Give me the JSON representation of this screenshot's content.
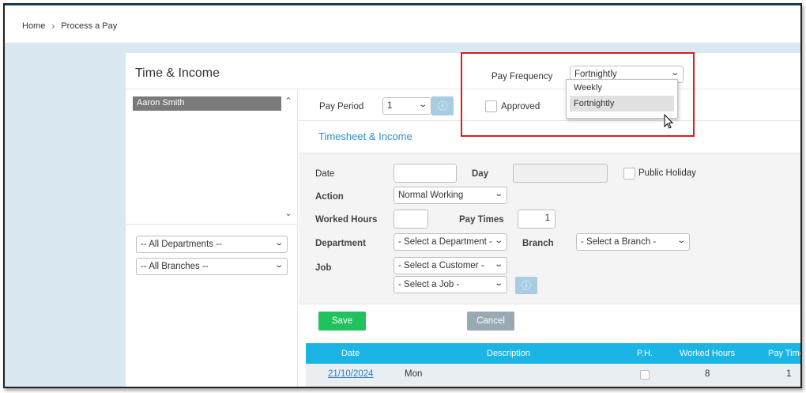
{
  "breadcrumb": {
    "home": "Home",
    "separator": "›",
    "current": "Process a Pay"
  },
  "panel": {
    "title": "Time & Income"
  },
  "employees": {
    "items": [
      "Aaron Smith"
    ]
  },
  "filters": {
    "departments": "-- All Departments --",
    "branches": "-- All Branches --"
  },
  "pay_frequency": {
    "label": "Pay Frequency",
    "selected": "Fortnightly",
    "options": [
      "Weekly",
      "Fortnightly"
    ]
  },
  "pay_period": {
    "label": "Pay Period",
    "value": "1"
  },
  "approved": {
    "label": "Approved"
  },
  "section_title": "Timesheet & Income",
  "form": {
    "date_label": "Date",
    "day_label": "Day",
    "public_holiday_label": "Public Holiday",
    "action_label": "Action",
    "action_value": "Normal Working",
    "worked_hours_label": "Worked Hours",
    "pay_times_label": "Pay Times",
    "pay_times_value": "1",
    "department_label": "Department",
    "department_value": "- Select a Department -",
    "branch_label": "Branch",
    "branch_value": "- Select a Branch -",
    "job_label": "Job",
    "customer_value": "- Select a Customer -",
    "job_value": "- Select a Job -"
  },
  "buttons": {
    "save": "Save",
    "cancel": "Cancel"
  },
  "table": {
    "headers": [
      "Date",
      "Description",
      "P.H.",
      "Worked Hours",
      "Pay Time"
    ],
    "rows": [
      {
        "date": "21/10/2024",
        "description": "Mon",
        "worked_hours": "8",
        "pay_times": "1"
      }
    ]
  },
  "colors": {
    "accent": "#1ab4e5",
    "save": "#21c25e",
    "cancel": "#9aaab4",
    "highlight": "#e01b1b"
  }
}
